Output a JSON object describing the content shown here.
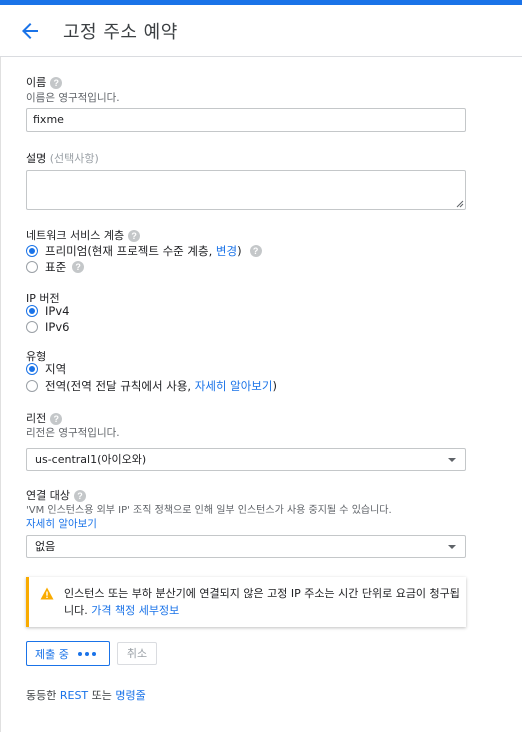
{
  "header": {
    "title": "고정 주소 예약"
  },
  "name": {
    "label": "이름",
    "hint": "이름은 영구적입니다.",
    "value": "fixme"
  },
  "description": {
    "label": "설명",
    "optional": "(선택사항)"
  },
  "network_tier": {
    "label": "네트워크 서비스 계층",
    "options": [
      {
        "label": "프리미엄(현재 프로젝트 수준 계층, ",
        "link": "변경",
        "suffix": ")",
        "checked": true
      },
      {
        "label": "표준",
        "checked": false
      }
    ]
  },
  "ip_version": {
    "label": "IP 버전",
    "options": [
      {
        "label": "IPv4",
        "checked": true
      },
      {
        "label": "IPv6",
        "checked": false
      }
    ]
  },
  "type": {
    "label": "유형",
    "options": [
      {
        "label": "지역",
        "checked": true
      },
      {
        "label": "전역(전역 전달 규칙에서 사용, ",
        "link": "자세히 알아보기",
        "suffix": ")",
        "checked": false
      }
    ]
  },
  "region": {
    "label": "리전",
    "hint": "리전은 영구적입니다.",
    "value": "us-central1(아이오와)"
  },
  "attached_to": {
    "label": "연결 대상",
    "hint": "'VM 인스턴스용 외부 IP' 조직 정책으로 인해 일부 인스턴스가 사용 중지될 수 있습니다.",
    "learn_more": "자세히 알아보기",
    "value": "없음"
  },
  "warning": {
    "text": "인스턴스 또는 부하 분산기에 연결되지 않은 고정 IP 주소는 시간 단위로 요금이 청구됩니다. ",
    "link": "가격 책정 세부정보"
  },
  "actions": {
    "submit": "제출 중",
    "cancel": "취소"
  },
  "footer": {
    "prefix": "동등한 ",
    "rest": "REST",
    "middle": " 또는 ",
    "cmd": "명령줄"
  },
  "colors": {
    "accent": "#1a73e8",
    "warning": "#f9ab00"
  }
}
